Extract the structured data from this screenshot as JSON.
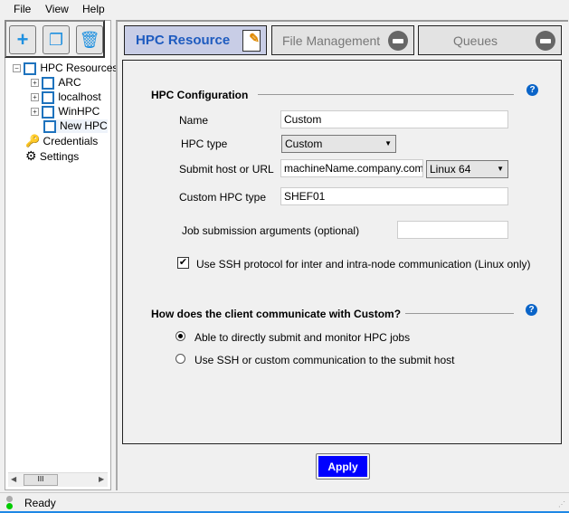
{
  "menu": [
    "File",
    "View",
    "Help"
  ],
  "toolbar": {
    "add": "add-icon",
    "copy": "copy-icon",
    "delete": "trash-icon"
  },
  "tree": {
    "root": "HPC Resources",
    "children": [
      "ARC",
      "localhost",
      "WinHPC",
      "New HPC"
    ],
    "credentials": "Credentials",
    "settings": "Settings"
  },
  "tabs": [
    {
      "label": "HPC Resource"
    },
    {
      "label": "File Management"
    },
    {
      "label": "Queues"
    }
  ],
  "config": {
    "title": "HPC Configuration",
    "name_label": "Name",
    "name_value": "Custom",
    "type_label": "HPC type",
    "type_value": "Custom",
    "host_label": "Submit host or URL",
    "host_value": "machineName.company.com",
    "os_value": "Linux 64",
    "custom_label": "Custom HPC type",
    "custom_value": "SHEF01",
    "args_label": "Job submission arguments (optional)",
    "args_value": "",
    "ssh_label": "Use SSH protocol for inter and intra-node communication (Linux only)",
    "ssh_checked": true
  },
  "comm": {
    "title": "How does the client communicate with Custom?",
    "options": [
      "Able to directly submit and monitor HPC jobs",
      "Use SSH or custom communication to the submit host"
    ],
    "selected": 0
  },
  "apply": "Apply",
  "status": "Ready",
  "colors": {
    "accent": "#0000ff",
    "tab_active": "#c8cde6",
    "link": "#1e5bbf"
  }
}
